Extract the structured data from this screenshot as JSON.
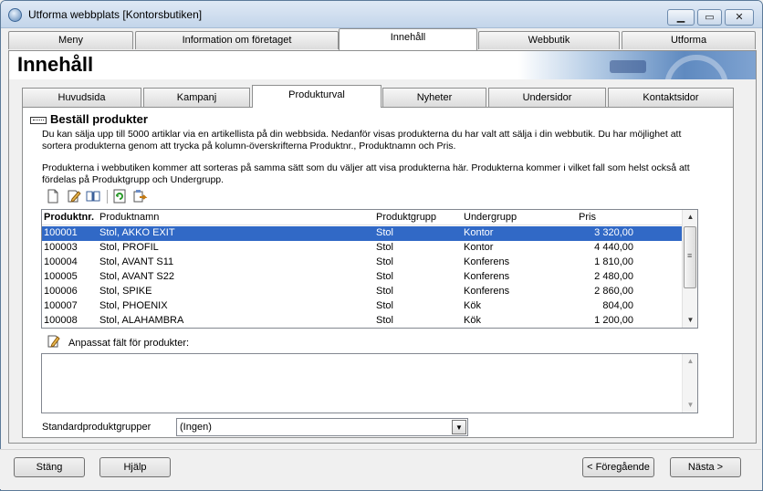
{
  "window": {
    "title": "Utforma webbplats [Kontorsbutiken]"
  },
  "main_tabs": [
    "Meny",
    "Information om företaget",
    "Innehåll",
    "Webbutik",
    "Utforma"
  ],
  "header": {
    "title": "Innehåll"
  },
  "sub_tabs": [
    "Huvudsida",
    "Kampanj",
    "Produkturval",
    "Nyheter",
    "Undersidor",
    "Kontaktsidor"
  ],
  "section": {
    "title": "Beställ produkter",
    "para1_line1": "Du kan sälja upp till 5000 artiklar via en artikellista på din webbsida. Nedanför visas produkterna du har valt att sälja i din webbutik. Du har möjlighet att",
    "para1_line2": "sortera produkterna genom att trycka på kolumn-överskrifterna Produktnr., Produktnamn och Pris.",
    "para2_line1": "Produkterna i webbutiken kommer att sorteras på samma sätt som du väljer att visa produkterna här. Produkterna kommer i vilket fall som helst också att",
    "para2_line2": "fördelas på Produktgrupp och Undergrupp."
  },
  "toolbar_icons": [
    "new-icon",
    "edit-icon",
    "book-icon",
    "refresh-icon",
    "export-icon"
  ],
  "table": {
    "columns": [
      "Produktnr.",
      "Produktnamn",
      "Produktgrupp",
      "Undergrupp",
      "Pris"
    ],
    "rows": [
      [
        "100001",
        "Stol, AKKO EXIT",
        "Stol",
        "Kontor",
        "3 320,00"
      ],
      [
        "100003",
        "Stol, PROFIL",
        "Stol",
        "Kontor",
        "4 440,00"
      ],
      [
        "100004",
        "Stol, AVANT S11",
        "Stol",
        "Konferens",
        "1 810,00"
      ],
      [
        "100005",
        "Stol, AVANT S22",
        "Stol",
        "Konferens",
        "2 480,00"
      ],
      [
        "100006",
        "Stol, SPIKE",
        "Stol",
        "Konferens",
        "2 860,00"
      ],
      [
        "100007",
        "Stol, PHOENIX",
        "Stol",
        "Kök",
        "804,00"
      ],
      [
        "100008",
        "Stol, ALAHAMBRA",
        "Stol",
        "Kök",
        "1 200,00"
      ]
    ],
    "selected_index": 0
  },
  "custom_fields": {
    "label": "Anpassat fält för produkter:",
    "value": ""
  },
  "standard_group": {
    "label": "Standardproduktgrupper",
    "value": "(Ingen)"
  },
  "buttons": {
    "close": "Stäng",
    "help": "Hjälp",
    "prev": "< Föregående",
    "next": "Nästa >"
  },
  "colors": {
    "selection": "#3169c6",
    "title_gradient_top": "#dfe9f5"
  }
}
